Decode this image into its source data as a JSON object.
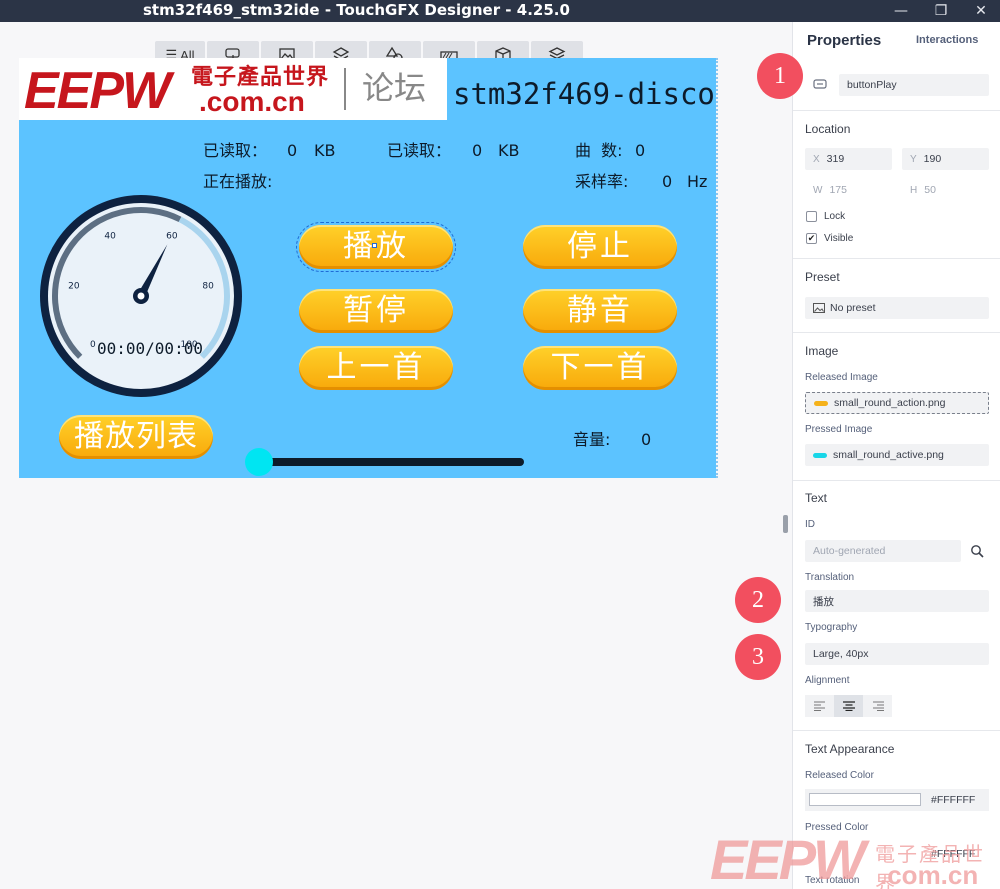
{
  "window": {
    "title": "stm32f469_stm32ide - TouchGFX Designer - 4.25.0",
    "minimize_glyph": "—",
    "maximize_glyph": "❐",
    "close_glyph": "✕"
  },
  "filter_bar": {
    "all_label": "All",
    "icons": [
      "interactive-icon",
      "image-icon",
      "container-icon",
      "shape-icon",
      "progress-icon",
      "3d-icon",
      "layers-icon"
    ]
  },
  "screen": {
    "logo": {
      "brand": "EEPW",
      "cn_name": "電子產品世界",
      "domain": ".com.cn",
      "forum": "论坛"
    },
    "board_name": "stm32f469-disco",
    "stats": {
      "read1_label": "已读取：",
      "read1_value": "0",
      "read1_unit": "KB",
      "read2_label": "已读取：",
      "read2_value": "0",
      "read2_unit": "KB",
      "tracks_label": "曲  数:",
      "tracks_value": "0",
      "playing_label": "正在播放:",
      "sample_label": "采样率:",
      "sample_value": "0",
      "sample_unit": "Hz"
    },
    "gauge": {
      "ticks": [
        "0",
        "20",
        "40",
        "60",
        "80",
        "100"
      ],
      "value": 60,
      "time": "00:00/00:00"
    },
    "buttons": {
      "play": "播放",
      "stop": "停止",
      "pause": "暂停",
      "mute": "静音",
      "prev": "上一首",
      "next": "下一首",
      "playlist": "播放列表"
    },
    "volume": {
      "label": "音量:",
      "value": "0",
      "level": 0
    }
  },
  "properties": {
    "tabs": {
      "properties": "Properties",
      "interactions": "Interactions"
    },
    "widget_name": "buttonPlay",
    "location": {
      "section": "Location",
      "x_label": "X",
      "x": "319",
      "y_label": "Y",
      "y": "190",
      "w_label": "W",
      "w": "175",
      "h_label": "H",
      "h": "50",
      "lock_label": "Lock",
      "visible_label": "Visible",
      "check_glyph": "✔"
    },
    "preset": {
      "section": "Preset",
      "value": "No preset"
    },
    "image": {
      "section": "Image",
      "released_label": "Released Image",
      "released_value": "small_round_action.png",
      "released_color": "#f5b21b",
      "pressed_label": "Pressed Image",
      "pressed_value": "small_round_active.png",
      "pressed_color": "#18d6e8"
    },
    "text": {
      "section": "Text",
      "id_label": "ID",
      "id_placeholder": "Auto-generated",
      "translation_label": "Translation",
      "translation_value": "播放",
      "typography_label": "Typography",
      "typography_value": "Large, 40px",
      "alignment_label": "Alignment"
    },
    "appearance": {
      "section": "Text Appearance",
      "released_color_label": "Released Color",
      "released_color_value": "#FFFFFF",
      "pressed_color_label": "Pressed Color",
      "pressed_color_value": "#FFFFFF",
      "rotation_label": "Text rotation"
    }
  },
  "markers": [
    "1",
    "2",
    "3"
  ],
  "watermark": {
    "brand": "EEPW",
    "cn_name": "電子產品世界",
    "domain": ".com.cn"
  },
  "colors": {
    "screen_bg": "#5cc3ff",
    "button_yellow": "#f8a80a",
    "slider_thumb": "#00e5f2",
    "marker_red": "#f24f5f",
    "titlebar": "#2b3446"
  }
}
